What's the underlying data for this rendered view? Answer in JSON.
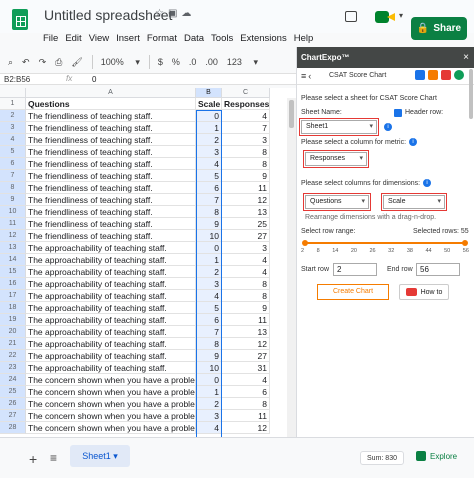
{
  "app": {
    "title": "Untitled spreadsheet",
    "share_label": "Share"
  },
  "menu": [
    "File",
    "Edit",
    "View",
    "Insert",
    "Format",
    "Data",
    "Tools",
    "Extensions",
    "Help"
  ],
  "toolbar": {
    "zoom": "100%",
    "currency": "$",
    "percent": "%",
    "dec_less": ".0",
    "dec_more": ".00",
    "number_format": "123"
  },
  "formula_bar": {
    "name_box": "B2:B56",
    "fx": "fx",
    "value": "0"
  },
  "grid": {
    "columns": [
      "A",
      "B",
      "C"
    ],
    "row_numbers": [
      "1",
      "2",
      "3",
      "4",
      "5",
      "6",
      "7",
      "8",
      "9",
      "10",
      "11",
      "12",
      "13",
      "14",
      "15",
      "16",
      "17",
      "18",
      "19",
      "20",
      "21",
      "22",
      "23",
      "24",
      "25",
      "26",
      "27",
      "28"
    ],
    "header": [
      "Questions",
      "Scale",
      "Responses"
    ],
    "rows": [
      [
        "The friendliness of teaching staff.",
        "0",
        "4"
      ],
      [
        "The friendliness of teaching staff.",
        "1",
        "7"
      ],
      [
        "The friendliness of teaching staff.",
        "2",
        "3"
      ],
      [
        "The friendliness of teaching staff.",
        "3",
        "8"
      ],
      [
        "The friendliness of teaching staff.",
        "4",
        "8"
      ],
      [
        "The friendliness of teaching staff.",
        "5",
        "9"
      ],
      [
        "The friendliness of teaching staff.",
        "6",
        "11"
      ],
      [
        "The friendliness of teaching staff.",
        "7",
        "12"
      ],
      [
        "The friendliness of teaching staff.",
        "8",
        "13"
      ],
      [
        "The friendliness of teaching staff.",
        "9",
        "25"
      ],
      [
        "The friendliness of teaching staff.",
        "10",
        "27"
      ],
      [
        "The approachability of teaching staff.",
        "0",
        "3"
      ],
      [
        "The approachability of teaching staff.",
        "1",
        "4"
      ],
      [
        "The approachability of teaching staff.",
        "2",
        "4"
      ],
      [
        "The approachability of teaching staff.",
        "3",
        "8"
      ],
      [
        "The approachability of teaching staff.",
        "4",
        "8"
      ],
      [
        "The approachability of teaching staff.",
        "5",
        "9"
      ],
      [
        "The approachability of teaching staff.",
        "6",
        "11"
      ],
      [
        "The approachability of teaching staff.",
        "7",
        "13"
      ],
      [
        "The approachability of teaching staff.",
        "8",
        "12"
      ],
      [
        "The approachability of teaching staff.",
        "9",
        "27"
      ],
      [
        "The approachability of teaching staff.",
        "10",
        "31"
      ],
      [
        "The concern shown when you have a problem.",
        "0",
        "4"
      ],
      [
        "The concern shown when you have a problem.",
        "1",
        "6"
      ],
      [
        "The concern shown when you have a problem.",
        "2",
        "8"
      ],
      [
        "The concern shown when you have a problem.",
        "3",
        "11"
      ],
      [
        "The concern shown when you have a problem.",
        "4",
        "12"
      ]
    ]
  },
  "tabs": {
    "sheet_name": "Sheet1",
    "sum": "Sum: 830",
    "explore": "Explore"
  },
  "panel": {
    "header": "ChartExpo™",
    "close": "×",
    "chart_title": "CSAT Score Chart",
    "select_sheet_label": "Please select a sheet for CSAT Score Chart",
    "sheet_name_label": "Sheet Name:",
    "sheet_value": "Sheet1",
    "header_row_label": "Header row:",
    "metric_label": "Please select a column for metric:",
    "metric_value": "Responses",
    "dimensions_label": "Please select columns for dimensions:",
    "dim1_value": "Questions",
    "dim2_value": "Scale",
    "rearrange_hint": "Rearrange dimensions with a drag-n-drop.",
    "row_range_label": "Select row range:",
    "selected_rows": "Selected rows: 55",
    "ticks": [
      "2",
      "8",
      "14",
      "20",
      "26",
      "32",
      "38",
      "44",
      "50",
      "56"
    ],
    "start_row_label": "Start row",
    "start_row_value": "2",
    "end_row_label": "End row",
    "end_row_value": "56",
    "create_label": "Create Chart",
    "howto_label": "How to"
  },
  "colors": {
    "accent": "#f57c00",
    "highlight": "#e53935",
    "share": "#0b8043",
    "selection": "#1a73e8"
  }
}
